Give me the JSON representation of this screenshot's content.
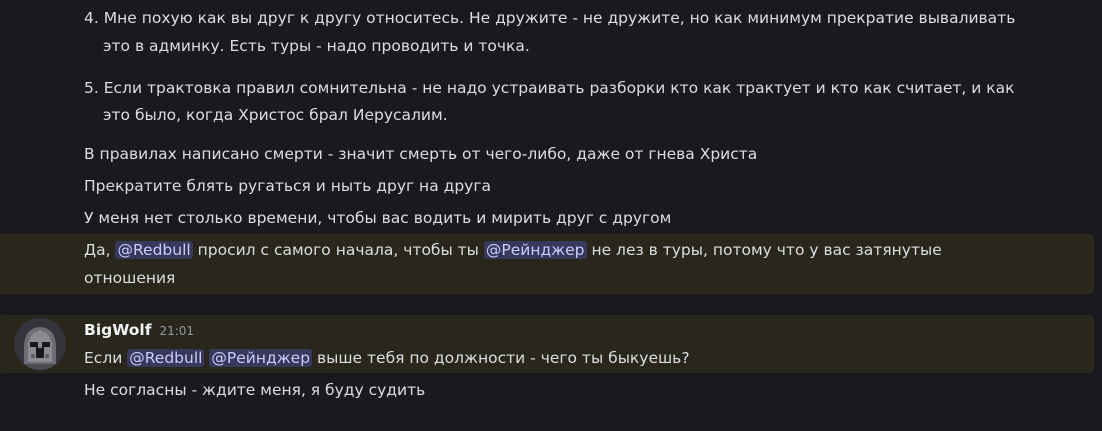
{
  "messages_top": {
    "item4": {
      "number": "4.",
      "line1": "Мне похую как вы друг к другу относитесь. Не дружите - не дружите, но как минимум прекратие вываливать",
      "line2": "это в админку. Есть туры - надо проводить и точка."
    },
    "item5": {
      "number": "5.",
      "line1": "Если трактовка правил сомнительна - не надо устраивать разборки кто как трактует и кто как считает, и как",
      "line2": "это было, когда Христос брал Иерусалим."
    },
    "msg1": "В правилах написано смерти - значит смерть от чего-либо, даже от гнева Христа",
    "msg2": "Прекратите блять ругаться и ныть друг на друга",
    "msg3": "У меня нет столько времени, чтобы вас водить и мирить друг с другом",
    "msg4": {
      "part1": "Да, ",
      "mention1": "@Redbull",
      "part2": " просил с самого начала, чтобы ты ",
      "mention2": "@Рейнджер",
      "part3": " не лез в туры, потому что у вас затянутые",
      "line2": "отношения"
    }
  },
  "group2": {
    "username": "BigWolf",
    "timestamp": "21:01",
    "msg1": {
      "part1": "Если ",
      "mention1": "@Redbull",
      "mention2": "@Рейнджер",
      "part2": " выше тебя по должности - чего ты быкуешь?"
    },
    "msg2": "Не согласны - ждите меня, я буду судить"
  },
  "colors": {
    "background": "#1a1a1e",
    "highlight": "#29261c",
    "mention_bg": "#3a3f7a",
    "mention_text": "#c9cdfb",
    "text": "#dbdee1"
  }
}
